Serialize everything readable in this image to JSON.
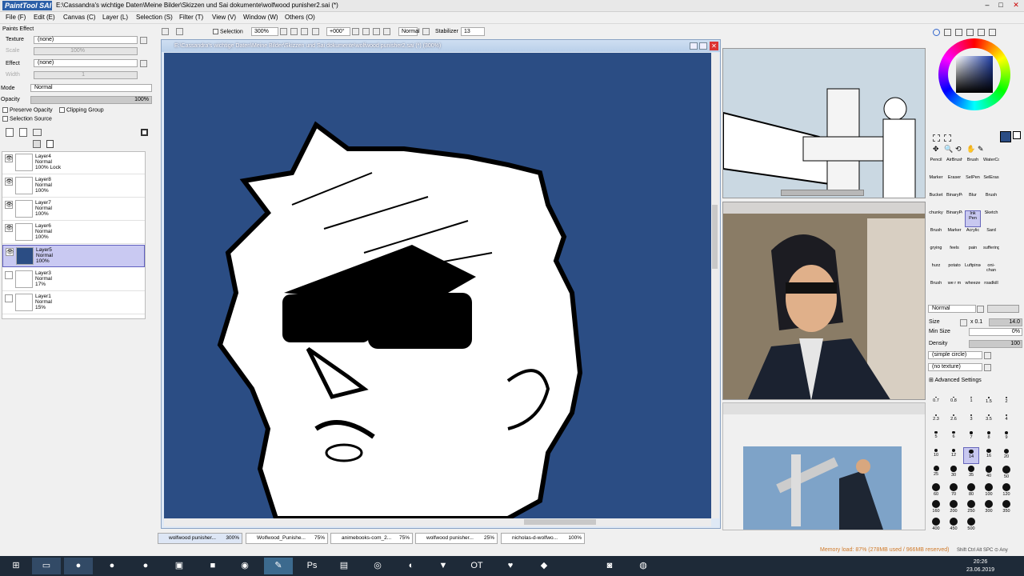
{
  "app": {
    "title": "E:\\Cassandra's wichtige Daten\\Meine Bilder\\Skizzen und Sai dokumente\\wolfwood punisher2.sai (*)",
    "logo": "PaintTool SAI"
  },
  "menu": [
    "File (F)",
    "Edit (E)",
    "Canvas (C)",
    "Layer (L)",
    "Selection (S)",
    "Filter (T)",
    "View (V)",
    "Window (W)",
    "Others (O)"
  ],
  "paper_effect": {
    "header": "Paints Effect",
    "texture_label": "Texture",
    "texture_value": "(none)",
    "scale_label": "Scale",
    "scale_value": "100%",
    "effect_label": "Effect",
    "effect_value": "(none)",
    "width_label": "Width",
    "width_value": "1"
  },
  "blend": {
    "mode_label": "Mode",
    "mode_value": "Normal",
    "opacity_label": "Opacity",
    "opacity_value": "100%"
  },
  "options": {
    "preserve_opacity": "Preserve Opacity",
    "clipping_group": "Clipping Group",
    "selection_source": "Selection Source"
  },
  "layers": [
    {
      "name": "Layer4",
      "mode": "Normal",
      "opacity": "100% Lock"
    },
    {
      "name": "Layer8",
      "mode": "Normal",
      "opacity": "100%"
    },
    {
      "name": "Layer7",
      "mode": "Normal",
      "opacity": "100%"
    },
    {
      "name": "Layer6",
      "mode": "Normal",
      "opacity": "100%"
    },
    {
      "name": "Layer5",
      "mode": "Normal",
      "opacity": "100%"
    },
    {
      "name": "Layer3",
      "mode": "Normal",
      "opacity": "17%"
    },
    {
      "name": "Layer1",
      "mode": "Normal",
      "opacity": "15%"
    }
  ],
  "toolbar": {
    "selection": "Selection",
    "zoom": "300%",
    "rotation": "+000°",
    "mode": "Normal",
    "stabilizer_label": "Stabilizer",
    "stabilizer_value": "13"
  },
  "canvas": {
    "title": "E:\\Cassandra's wichtige Daten\\Meine Bilder\\Skizzen und Sai dokumente\\wolfwood punisher2.sai (*) (300%)"
  },
  "tools": {
    "brushes": [
      "Pencil",
      "AirBrush",
      "Brush",
      "WaterCo",
      "Marker",
      "Eraser",
      "SelPen",
      "SelEras",
      "Bucket",
      "BinaryPe",
      "Blur",
      "Brush",
      "chunky",
      "BinaryPe",
      "Ink Pen",
      "Sketch",
      "Brush",
      "Marker",
      "Acrylic",
      "Sard",
      "grying",
      "feels",
      "pain",
      "suffering",
      "hurz",
      "potato",
      "Luftpinse",
      "oni-chan",
      "Brush",
      "we r m",
      "wheeze",
      "roadkill"
    ],
    "blend_mode": "Normal",
    "size_label": "Size",
    "size_mult": "x 0.1",
    "size_value": "14.0",
    "minsize_label": "Min Size",
    "minsize_value": "0%",
    "density_label": "Density",
    "density_value": "100",
    "shape": "(simple circle)",
    "texture": "(no texture)",
    "advanced": "Advanced Settings",
    "sizes": [
      "0.7",
      "0.8",
      "1",
      "1.5",
      "2",
      "2.3",
      "2.6",
      "3",
      "3.5",
      "4",
      "5",
      "6",
      "7",
      "8",
      "9",
      "10",
      "12",
      "14",
      "16",
      "20",
      "25",
      "30",
      "35",
      "40",
      "50",
      "60",
      "70",
      "80",
      "100",
      "120",
      "160",
      "200",
      "250",
      "300",
      "350",
      "400",
      "450",
      "500"
    ],
    "selected_size": "14"
  },
  "tabs": [
    {
      "label": "wolfwood punisher...",
      "zoom": "300%"
    },
    {
      "label": "Wolfwood_Punishe...",
      "zoom": "75%"
    },
    {
      "label": "animebooks-com_2...",
      "zoom": "75%"
    },
    {
      "label": "wolfwood punisher...",
      "zoom": "25%"
    },
    {
      "label": "nicholas-d-wolfwo...",
      "zoom": "100%"
    }
  ],
  "status": {
    "memory": "Memory load: 87% (278MB used / 966MB reserved)",
    "keys": "Shift Ctrl Alt SPC ⊙ Any"
  },
  "clock": {
    "time": "20:26",
    "date": "23.06.2019"
  },
  "colors": {
    "canvas_bg": "#2b4d84",
    "selected_layer": "#c9c9f2",
    "accent": "#6060c0"
  }
}
